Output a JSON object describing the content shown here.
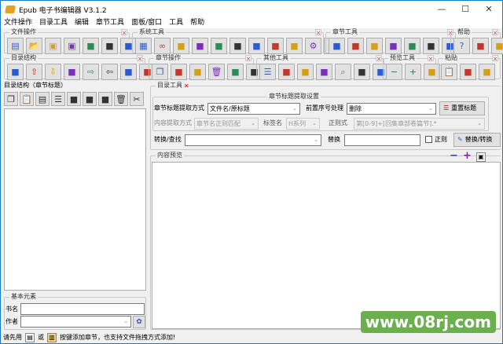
{
  "window": {
    "title": "Epub 电子书编辑器 V3.1.2",
    "minimize": "—",
    "maximize": "☐",
    "close": "✕"
  },
  "menu": [
    "文件操作",
    "目录工具",
    "编辑",
    "章节工具",
    "面板/窗口",
    "工具",
    "帮助"
  ],
  "toolbars": {
    "file": {
      "label": "文件操作",
      "icons": [
        "new-icon",
        "open-icon",
        "save-icon",
        "save-as-icon",
        "book-info-icon",
        "import-icon",
        "export-icon"
      ]
    },
    "system": {
      "label": "系统工具",
      "icons": [
        "pdf-icon",
        "binoculars-icon",
        "convert-icon",
        "preview-icon",
        "link-icon",
        "view-icon",
        "code-icon",
        "window-icon",
        "layout-icon",
        "gear-icon",
        "comment-icon"
      ]
    },
    "chapter": {
      "label": "章节工具",
      "icons": [
        "chart-icon",
        "split-icon",
        "merge-icon",
        "sort-icon",
        "table-icon",
        "align-icon",
        "format-icon"
      ]
    },
    "help": {
      "label": "帮助",
      "icons": [
        "help-icon",
        "about-icon",
        "feedback-icon"
      ]
    },
    "toc": {
      "label": "目录结构",
      "icons": [
        "move-top-icon",
        "move-up-icon",
        "move-down-icon",
        "move-bottom-icon",
        "indent-icon",
        "outdent-icon",
        "toc-gen-icon",
        "toc-import-icon"
      ]
    },
    "chapterops": {
      "label": "章节操作",
      "icons": [
        "copy-icon",
        "paste-folder-icon",
        "new-page-icon",
        "delete-icon",
        "chapter-info-icon",
        "chapter-export-icon"
      ]
    },
    "other": {
      "label": "其他工具",
      "icons": [
        "list-icon",
        "target-icon",
        "replace-icon",
        "bookmark-icon",
        "search-icon",
        "indent-more-icon",
        "indent-less-icon"
      ]
    },
    "preview": {
      "label": "预览工具",
      "icons": [
        "zoom-out-icon",
        "zoom-in-icon",
        "glasses-icon"
      ]
    },
    "paste": {
      "label": "粘贴",
      "icons": [
        "paste-icon",
        "paste-text-icon",
        "paste-special-icon"
      ]
    }
  },
  "left": {
    "toc_title": "目录结构（章节标题）",
    "toc_icons": [
      "copy-icon",
      "paste-icon",
      "new-icon",
      "list-icon",
      "move-icon",
      "right-icon",
      "left-icon",
      "delete-icon",
      "tools-icon"
    ],
    "basic_title": "基本元素",
    "book_name_label": "书名",
    "book_name": "",
    "author_label": "作者",
    "author": ""
  },
  "right": {
    "tab_label": "目录工具",
    "settings_title": "章节标题提取设置",
    "extract_mode_label": "章节标题提取方式",
    "extract_mode": "文件名/原标题",
    "prefix_label": "前置序号处理",
    "prefix": "删除",
    "reset_button": "重置标题",
    "content_mode_label": "内容提取方式",
    "content_mode": "章节名正则匹配",
    "tag_label": "标签名",
    "tag": "H系列",
    "regex_label": "正则式",
    "regex": "第[0-9]+[回集章部卷篇节].*",
    "find_label": "转换/查找",
    "find": "",
    "replace_label": "替换",
    "replace": "",
    "regex_check": "正则",
    "replace_button": "替换/转换",
    "preview_title": "内容预览"
  },
  "status": {
    "prefix": "请先用",
    "or": "或",
    "suffix": "按键添加章节，也支持文件拖拽方式添加!"
  },
  "watermark": "www.08rj.com"
}
